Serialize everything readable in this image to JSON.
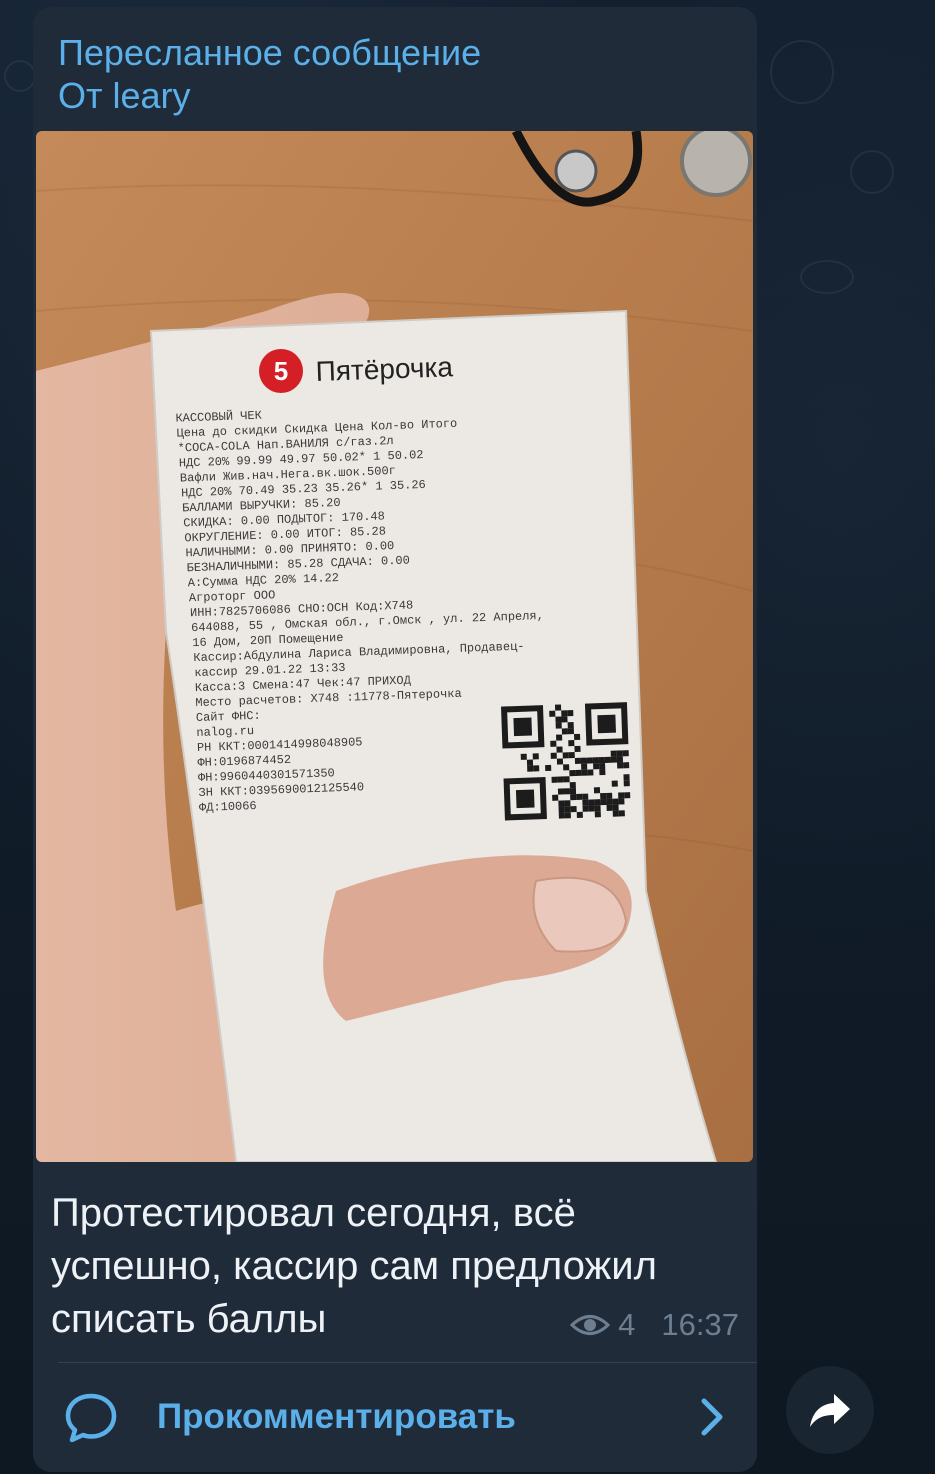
{
  "forwarded": {
    "title": "Пересланное сообщение",
    "from": "От leary"
  },
  "photo": {
    "receipt": {
      "brand": "Пятёрочка",
      "lines": [
        "КАССОВЫЙ ЧЕК",
        "Цена до скидки   Скидка   Цена Кол-во   Итого",
        "*COCA-COLA Нап.ВАНИЛЯ с/газ.2л",
        "НДС 20%    99.99   49.97   50.02*   1   50.02",
        "Вафли Жив.нач.Нега.вк.шок.500г",
        "НДС 20%    70.49   35.23   35.26*   1   35.26",
        "БАЛЛАМИ ВЫРУЧКИ:   85.20",
        "СКИДКА:            0.00 ПОДЫТОГ:    170.48",
        "ОКРУГЛЕНИЕ:        0.00 ИТОГ:        85.28",
        "НАЛИЧНЫМИ:         0.00 ПРИНЯТО:      0.00",
        "БЕЗНАЛИЧНЫМИ:     85.28 СДАЧА:        0.00",
        "А:Сумма НДС 20%    14.22",
        "Агроторг ООО",
        "ИНН:7825706086     СНО:ОСН      Код:X748",
        "644088, 55 , Омская обл., г.Омск , ул. 22 Апреля,",
        "16 Дом, 20П Помещение",
        "Кассир:Абдулина Лариса Владимировна, Продавец-",
        "кассир                       29.01.22 13:33",
        "Касса:3     Смена:47    Чек:47       ПРИХОД",
        "Место расчетов:          X748 :11778-Пятерочка",
        "Сайт ФНС:",
        "nalog.ru",
        "РН ККТ:0001414998048905",
        "ФН:0196874452",
        "ФН:9960440301571350",
        "ЗН ККТ:0395690012125540",
        "ФД:10066"
      ]
    }
  },
  "caption": "Протестировал сегодня, всё успешно, кассир сам предложил списать баллы",
  "meta": {
    "views": "4",
    "time": "16:37"
  },
  "comments": {
    "label": "Прокомментировать"
  },
  "colors": {
    "accent": "#5cb0ea",
    "bubble": "#1f2b39",
    "background": "#0f1924",
    "meta": "#6d7e90"
  }
}
